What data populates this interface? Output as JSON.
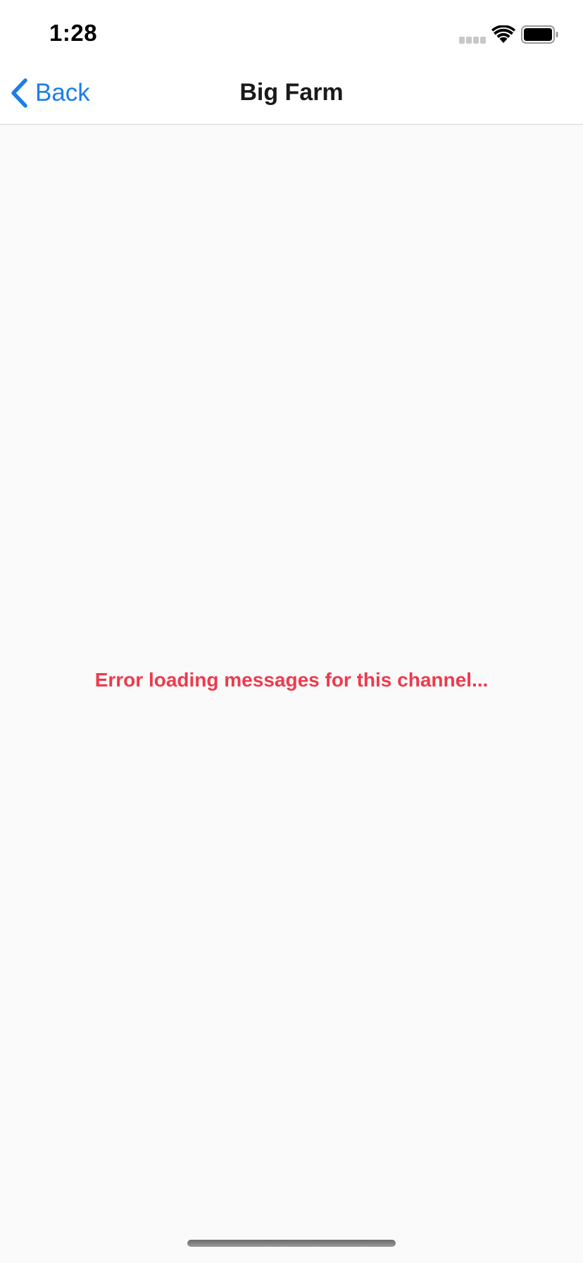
{
  "status_bar": {
    "time": "1:28",
    "icons": [
      "cellular-signal-icon",
      "wifi-icon",
      "battery-icon"
    ]
  },
  "nav": {
    "back_label": "Back",
    "title": "Big Farm",
    "back_icon": "chevron-left-icon"
  },
  "content": {
    "error_message": "Error loading messages for this channel..."
  },
  "colors": {
    "accent": "#1b7ee8",
    "error": "#ee3a4c",
    "background": "#fafafa",
    "nav_background": "#ffffff"
  }
}
